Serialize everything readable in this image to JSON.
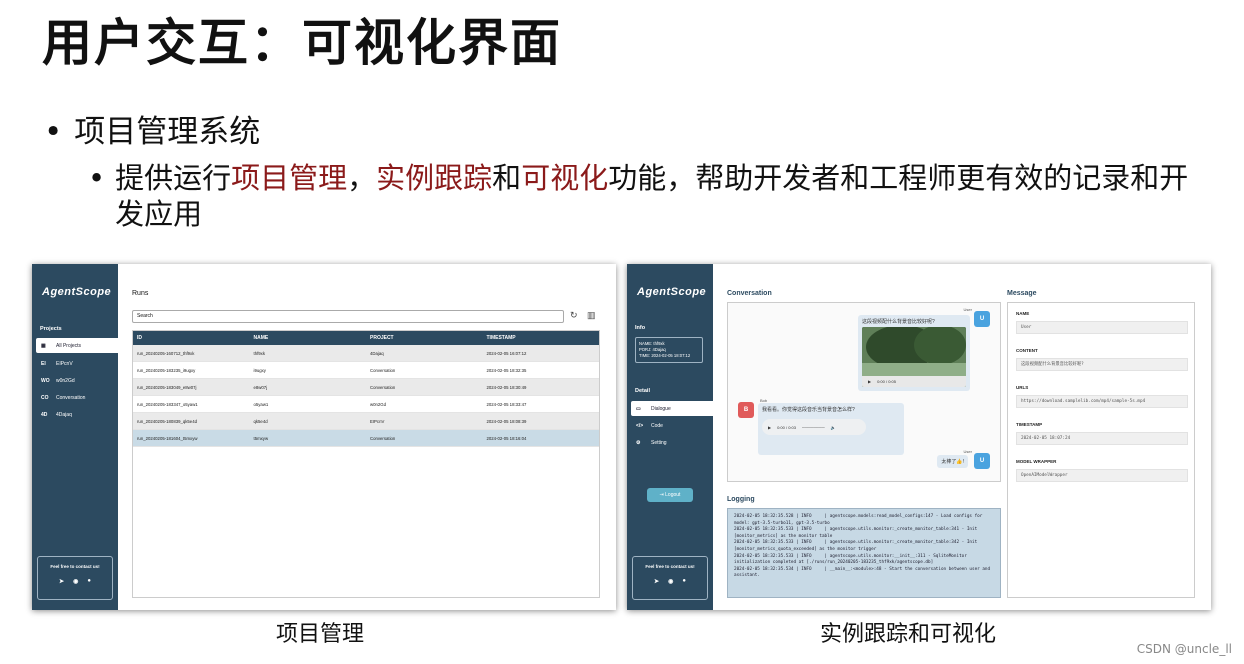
{
  "slide": {
    "title": "用户交互：可视化界面",
    "bullet1": "项目管理系统",
    "bullet2": {
      "p1": "提供运行",
      "hl1": "项目管理",
      "p2": "，",
      "hl2": "实例跟踪",
      "p3": "和",
      "hl3": "可视化",
      "p4": "功能，帮助开发者和工程师更有效的记录和开发应用"
    },
    "caption_left": "项目管理",
    "caption_right": "实例跟踪和可视化",
    "watermark": "CSDN @uncle_ll",
    "highlight_color": "#8b1a1a"
  },
  "left_app": {
    "logo": "AgentScope",
    "projects_label": "Projects",
    "sidebar_items": [
      {
        "abbr": "",
        "label": "All Projects"
      },
      {
        "abbr": "EI",
        "label": "EIPcnV"
      },
      {
        "abbr": "WO",
        "label": "w0n2Gd"
      },
      {
        "abbr": "CO",
        "label": "Conversation"
      },
      {
        "abbr": "4D",
        "label": "4Dajaq"
      }
    ],
    "contact_label": "Feel free to contact us!",
    "runs_title": "Runs",
    "search_placeholder": "Search",
    "columns": [
      "ID",
      "NAME",
      "PROJECT",
      "TIMESTAMP"
    ],
    "rows": [
      [
        "run_20240205-160712_thf9xk",
        "thf9xk",
        "4Dajaq",
        "2024-02-05 16:07:12"
      ],
      [
        "run_20240205-183235_i9ugxy",
        "i9ugxy",
        "Conversation",
        "2024-02-05 18:32:35"
      ],
      [
        "run_20240205-183049_e8w07j",
        "e8w07j",
        "Conversation",
        "2024-02-05 18:30:49"
      ],
      [
        "run_20240205-183347_o5yaw1",
        "o5yaw1",
        "w0n2Gd",
        "2024-02-05 18:33:47"
      ],
      [
        "run_20240205-180839_qk5e4d",
        "qk5e4d",
        "EIPcnV",
        "2024-02-05 18:08:39"
      ],
      [
        "run_20240205-181604_t5mxyw",
        "t5mxyw",
        "Conversation",
        "2024-02-05 18:16:04"
      ]
    ]
  },
  "right_app": {
    "logo": "AgentScope",
    "info_label": "Info",
    "info_lines": [
      "NAME: thf9xk",
      "PORJ: 4Dajaq",
      "TIME: 2024-02-05 18:07:12"
    ],
    "detail_label": "Detail",
    "detail_items": [
      "Dialogue",
      "Code",
      "Setting"
    ],
    "logout_label": "Logout",
    "contact_label": "Feel free to contact us!",
    "conversation_title": "Conversation",
    "user_name": "User",
    "user_avatar": "U",
    "bob_name": "Bob",
    "bob_avatar": "B",
    "user_msg1": "这段视频配什么背景音比较好呢?",
    "video_time": "0:00 / 0:05",
    "bob_msg": "我看看。你觉得这段音乐当背景音怎么样?",
    "audio_time": "0:00 / 0:03",
    "user_msg2": "太棒了👍!",
    "logging_title": "Logging",
    "log_text": "2024-02-05 18:32:35.528 | INFO     | agentscope.models:read_model_configs:147 - Load configs for model: gpt-3.5-turbo11, gpt-3.5-turbo\n2024-02-05 18:32:35.533 | INFO     | agentscope.utils.monitor:_create_monitor_table:341 - Init [monitor_metrics] as the monitor table\n2024-02-05 18:32:35.533 | INFO     | agentscope.utils.monitor:_create_monitor_table:342 - Init [monitor_metrics_quota_exceeded] as the monitor trigger\n2024-02-05 18:32:35.533 | INFO     | agentscope.utils.monitor:__init__:311 - SqliteMonitor initialization completed at [./runs/run_20240205-183235_thf9xk/agentscope.db]\n2024-02-05 18:32:35.534 | INFO     | __main__:<module>:48 - Start the conversation between user and assistant.",
    "message_title": "Message",
    "fields": [
      {
        "label": "NAME",
        "value": "User"
      },
      {
        "label": "CONTENT",
        "value": "这段视频配什么背景音比较好呢?"
      },
      {
        "label": "URLS",
        "value": "https://download.samplelib.com/mp4/sample-5s.mp4"
      },
      {
        "label": "TIMESTAMP",
        "value": "2024-02-05 18:07:24"
      },
      {
        "label": "MODEL WRAPPER",
        "value": "OpenAIModelWrapper"
      }
    ]
  }
}
